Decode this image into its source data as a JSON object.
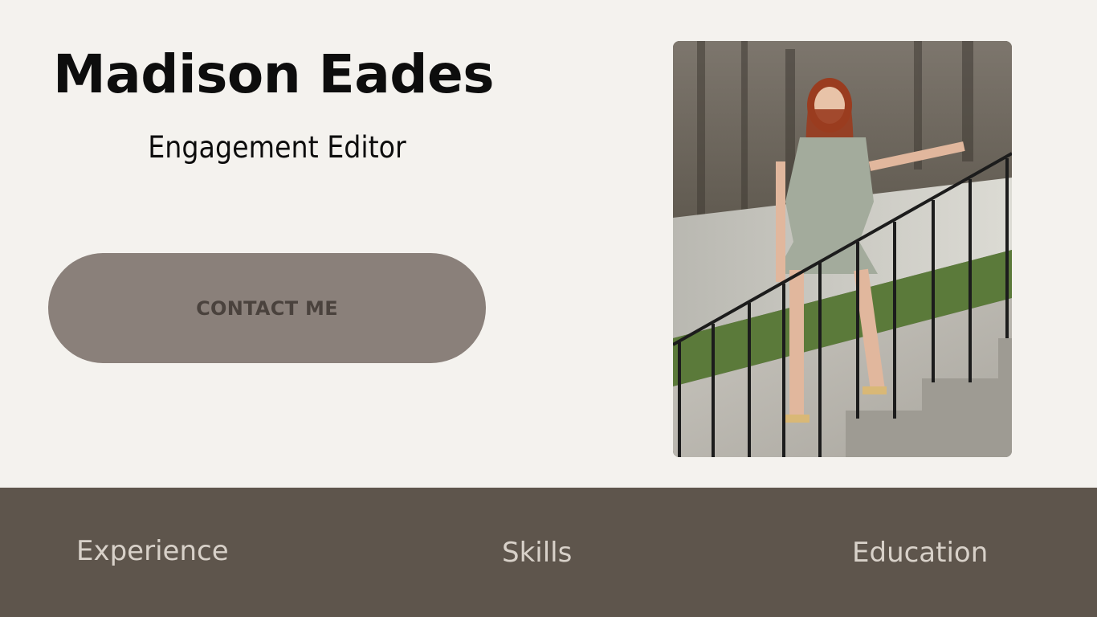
{
  "hero": {
    "name": "Madison Eades",
    "role": "Engagement Editor",
    "contact_button_label": "CONTACT ME"
  },
  "footer": {
    "nav": [
      {
        "label": "Experience"
      },
      {
        "label": "Skills"
      },
      {
        "label": "Education"
      }
    ]
  },
  "colors": {
    "page_background": "#f4f2ee",
    "button_background": "#8a807a",
    "button_text": "#4a423d",
    "footer_background": "#5e554c",
    "footer_text": "#d8d1c9"
  }
}
